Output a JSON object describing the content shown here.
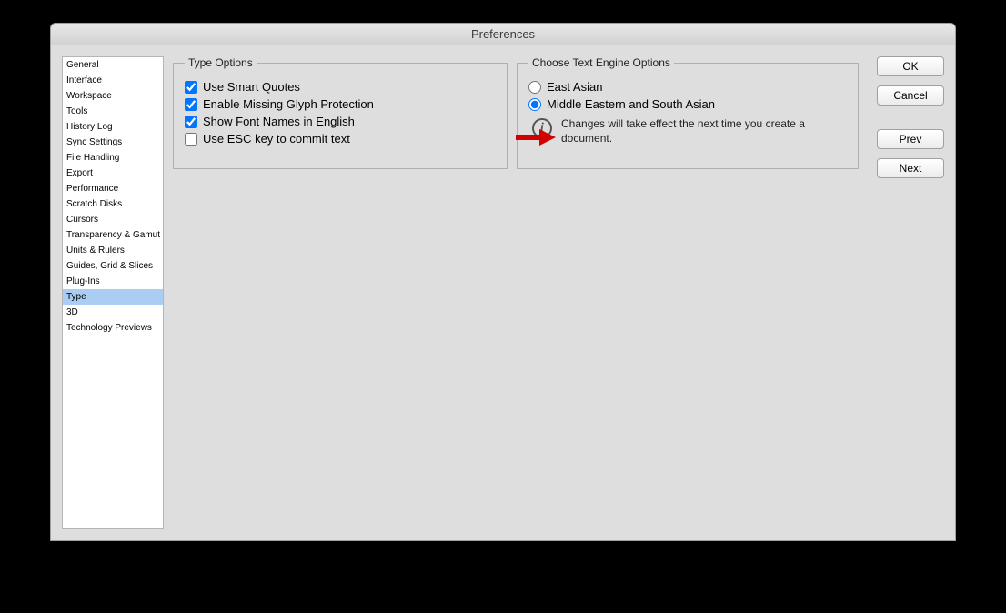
{
  "window": {
    "title": "Preferences"
  },
  "sidebar": {
    "items": [
      {
        "label": "General",
        "selected": false
      },
      {
        "label": "Interface",
        "selected": false
      },
      {
        "label": "Workspace",
        "selected": false
      },
      {
        "label": "Tools",
        "selected": false
      },
      {
        "label": "History Log",
        "selected": false
      },
      {
        "label": "Sync Settings",
        "selected": false
      },
      {
        "label": "File Handling",
        "selected": false
      },
      {
        "label": "Export",
        "selected": false
      },
      {
        "label": "Performance",
        "selected": false
      },
      {
        "label": "Scratch Disks",
        "selected": false
      },
      {
        "label": "Cursors",
        "selected": false
      },
      {
        "label": "Transparency & Gamut",
        "selected": false
      },
      {
        "label": "Units & Rulers",
        "selected": false
      },
      {
        "label": "Guides, Grid & Slices",
        "selected": false
      },
      {
        "label": "Plug-Ins",
        "selected": false
      },
      {
        "label": "Type",
        "selected": true
      },
      {
        "label": "3D",
        "selected": false
      },
      {
        "label": "Technology Previews",
        "selected": false
      }
    ]
  },
  "typeOptions": {
    "legend": "Type Options",
    "checks": [
      {
        "label": "Use Smart Quotes",
        "checked": true
      },
      {
        "label": "Enable Missing Glyph Protection",
        "checked": true
      },
      {
        "label": "Show Font Names in English",
        "checked": true
      },
      {
        "label": "Use ESC key to commit text",
        "checked": false
      }
    ]
  },
  "engineOptions": {
    "legend": "Choose Text Engine Options",
    "radios": [
      {
        "label": "East Asian",
        "checked": false
      },
      {
        "label": "Middle Eastern and South Asian",
        "checked": true
      }
    ],
    "info": "Changes will take effect the next time you create a document."
  },
  "buttons": {
    "ok": "OK",
    "cancel": "Cancel",
    "prev": "Prev",
    "next": "Next"
  }
}
